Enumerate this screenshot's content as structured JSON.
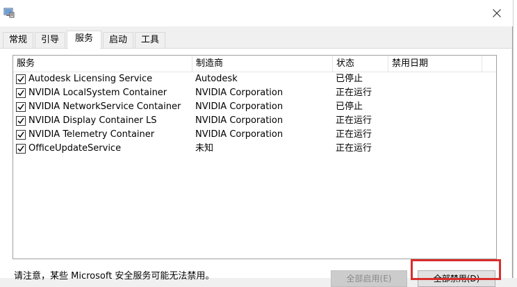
{
  "tabs": [
    {
      "label": "常规",
      "active": false
    },
    {
      "label": "引导",
      "active": false
    },
    {
      "label": "服务",
      "active": true
    },
    {
      "label": "启动",
      "active": false
    },
    {
      "label": "工具",
      "active": false
    }
  ],
  "table": {
    "columns": [
      "服务",
      "制造商",
      "状态",
      "禁用日期"
    ],
    "rows": [
      {
        "checked": true,
        "service": "Autodesk Licensing Service",
        "manufacturer": "Autodesk",
        "status": "已停止",
        "disabled_date": ""
      },
      {
        "checked": true,
        "service": "NVIDIA LocalSystem Container",
        "manufacturer": "NVIDIA Corporation",
        "status": "正在运行",
        "disabled_date": ""
      },
      {
        "checked": true,
        "service": "NVIDIA NetworkService Container",
        "manufacturer": "NVIDIA Corporation",
        "status": "已停止",
        "disabled_date": ""
      },
      {
        "checked": true,
        "service": "NVIDIA Display Container LS",
        "manufacturer": "NVIDIA Corporation",
        "status": "正在运行",
        "disabled_date": ""
      },
      {
        "checked": true,
        "service": "NVIDIA Telemetry Container",
        "manufacturer": "NVIDIA Corporation",
        "status": "正在运行",
        "disabled_date": ""
      },
      {
        "checked": true,
        "service": "OfficeUpdateService",
        "manufacturer": "未知",
        "status": "正在运行",
        "disabled_date": ""
      }
    ]
  },
  "footer": {
    "note": "请注意，某些 Microsoft 安全服务可能无法禁用。",
    "enable_all_label": "全部启用(E)",
    "disable_all_label": "全部禁用(D)"
  },
  "icons": {
    "app": "msconfig-icon",
    "close": "close-icon",
    "checkbox": "checkmark-icon"
  },
  "colors": {
    "highlight": "#d92d2d",
    "panel": "#ffffff",
    "chrome": "#f0f0f0"
  }
}
